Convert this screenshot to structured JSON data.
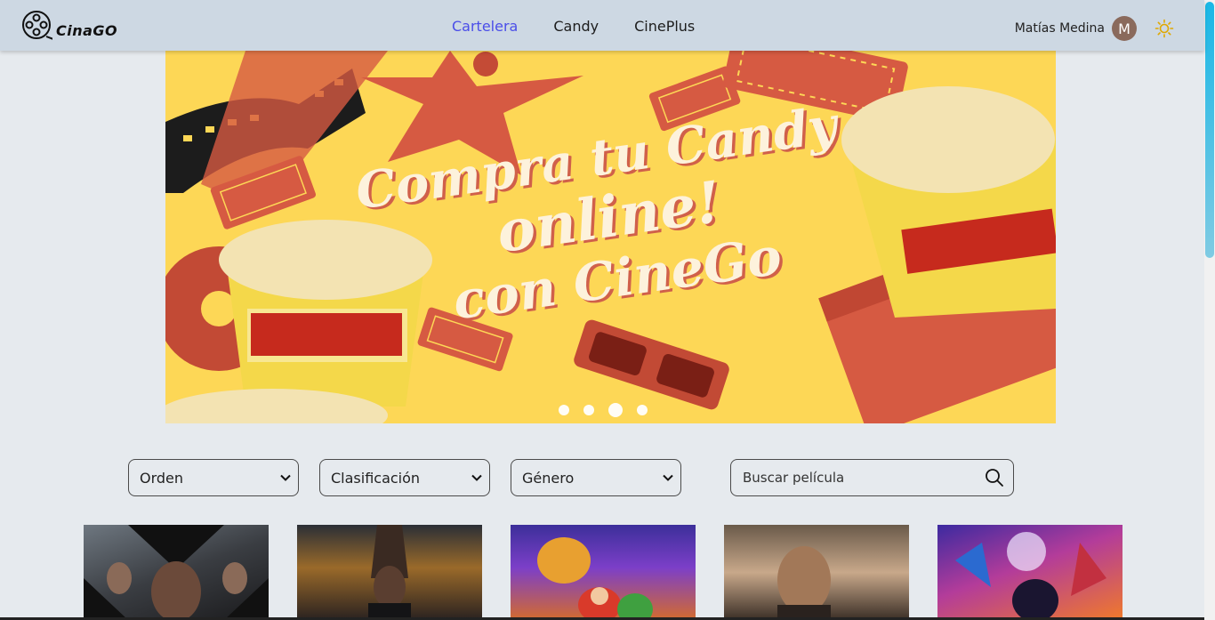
{
  "header": {
    "logo_text": "CinaGO",
    "nav": [
      {
        "label": "Cartelera",
        "active": true
      },
      {
        "label": "Candy",
        "active": false
      },
      {
        "label": "CinePlus",
        "active": false
      }
    ],
    "user_name": "Matías Medina",
    "avatar_initial": "M",
    "theme_icon": "sun-icon"
  },
  "banner": {
    "line1": "Compra tu Candy",
    "line2": "online!",
    "line3": "con CineGo",
    "slide_count": 4,
    "active_slide": 3
  },
  "filters": {
    "orden": "Orden",
    "clasificacion": "Clasificación",
    "genero": "Género",
    "search_placeholder": "Buscar película"
  },
  "colors": {
    "accent": "#4b4ee8",
    "header_bg": "#cdd8e3",
    "page_bg": "#e6eaee",
    "banner_bg": "#fdd756"
  }
}
